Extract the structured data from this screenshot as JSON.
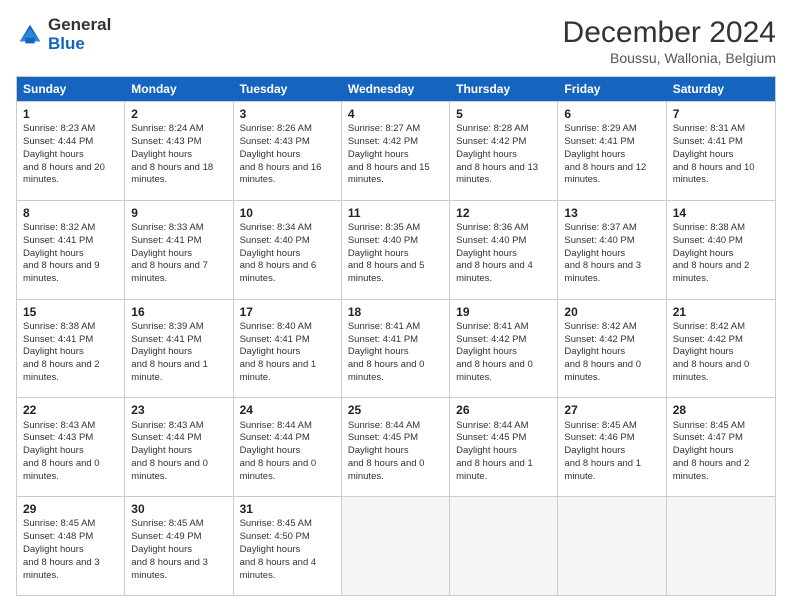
{
  "header": {
    "logo_general": "General",
    "logo_blue": "Blue",
    "month_title": "December 2024",
    "subtitle": "Boussu, Wallonia, Belgium"
  },
  "weekdays": [
    "Sunday",
    "Monday",
    "Tuesday",
    "Wednesday",
    "Thursday",
    "Friday",
    "Saturday"
  ],
  "weeks": [
    [
      {
        "day": "1",
        "sunrise": "8:23 AM",
        "sunset": "4:44 PM",
        "daylight": "8 hours and 20 minutes."
      },
      {
        "day": "2",
        "sunrise": "8:24 AM",
        "sunset": "4:43 PM",
        "daylight": "8 hours and 18 minutes."
      },
      {
        "day": "3",
        "sunrise": "8:26 AM",
        "sunset": "4:43 PM",
        "daylight": "8 hours and 16 minutes."
      },
      {
        "day": "4",
        "sunrise": "8:27 AM",
        "sunset": "4:42 PM",
        "daylight": "8 hours and 15 minutes."
      },
      {
        "day": "5",
        "sunrise": "8:28 AM",
        "sunset": "4:42 PM",
        "daylight": "8 hours and 13 minutes."
      },
      {
        "day": "6",
        "sunrise": "8:29 AM",
        "sunset": "4:41 PM",
        "daylight": "8 hours and 12 minutes."
      },
      {
        "day": "7",
        "sunrise": "8:31 AM",
        "sunset": "4:41 PM",
        "daylight": "8 hours and 10 minutes."
      }
    ],
    [
      {
        "day": "8",
        "sunrise": "8:32 AM",
        "sunset": "4:41 PM",
        "daylight": "8 hours and 9 minutes."
      },
      {
        "day": "9",
        "sunrise": "8:33 AM",
        "sunset": "4:41 PM",
        "daylight": "8 hours and 7 minutes."
      },
      {
        "day": "10",
        "sunrise": "8:34 AM",
        "sunset": "4:40 PM",
        "daylight": "8 hours and 6 minutes."
      },
      {
        "day": "11",
        "sunrise": "8:35 AM",
        "sunset": "4:40 PM",
        "daylight": "8 hours and 5 minutes."
      },
      {
        "day": "12",
        "sunrise": "8:36 AM",
        "sunset": "4:40 PM",
        "daylight": "8 hours and 4 minutes."
      },
      {
        "day": "13",
        "sunrise": "8:37 AM",
        "sunset": "4:40 PM",
        "daylight": "8 hours and 3 minutes."
      },
      {
        "day": "14",
        "sunrise": "8:38 AM",
        "sunset": "4:40 PM",
        "daylight": "8 hours and 2 minutes."
      }
    ],
    [
      {
        "day": "15",
        "sunrise": "8:38 AM",
        "sunset": "4:41 PM",
        "daylight": "8 hours and 2 minutes."
      },
      {
        "day": "16",
        "sunrise": "8:39 AM",
        "sunset": "4:41 PM",
        "daylight": "8 hours and 1 minute."
      },
      {
        "day": "17",
        "sunrise": "8:40 AM",
        "sunset": "4:41 PM",
        "daylight": "8 hours and 1 minute."
      },
      {
        "day": "18",
        "sunrise": "8:41 AM",
        "sunset": "4:41 PM",
        "daylight": "8 hours and 0 minutes."
      },
      {
        "day": "19",
        "sunrise": "8:41 AM",
        "sunset": "4:42 PM",
        "daylight": "8 hours and 0 minutes."
      },
      {
        "day": "20",
        "sunrise": "8:42 AM",
        "sunset": "4:42 PM",
        "daylight": "8 hours and 0 minutes."
      },
      {
        "day": "21",
        "sunrise": "8:42 AM",
        "sunset": "4:42 PM",
        "daylight": "8 hours and 0 minutes."
      }
    ],
    [
      {
        "day": "22",
        "sunrise": "8:43 AM",
        "sunset": "4:43 PM",
        "daylight": "8 hours and 0 minutes."
      },
      {
        "day": "23",
        "sunrise": "8:43 AM",
        "sunset": "4:44 PM",
        "daylight": "8 hours and 0 minutes."
      },
      {
        "day": "24",
        "sunrise": "8:44 AM",
        "sunset": "4:44 PM",
        "daylight": "8 hours and 0 minutes."
      },
      {
        "day": "25",
        "sunrise": "8:44 AM",
        "sunset": "4:45 PM",
        "daylight": "8 hours and 0 minutes."
      },
      {
        "day": "26",
        "sunrise": "8:44 AM",
        "sunset": "4:45 PM",
        "daylight": "8 hours and 1 minute."
      },
      {
        "day": "27",
        "sunrise": "8:45 AM",
        "sunset": "4:46 PM",
        "daylight": "8 hours and 1 minute."
      },
      {
        "day": "28",
        "sunrise": "8:45 AM",
        "sunset": "4:47 PM",
        "daylight": "8 hours and 2 minutes."
      }
    ],
    [
      {
        "day": "29",
        "sunrise": "8:45 AM",
        "sunset": "4:48 PM",
        "daylight": "8 hours and 3 minutes."
      },
      {
        "day": "30",
        "sunrise": "8:45 AM",
        "sunset": "4:49 PM",
        "daylight": "8 hours and 3 minutes."
      },
      {
        "day": "31",
        "sunrise": "8:45 AM",
        "sunset": "4:50 PM",
        "daylight": "8 hours and 4 minutes."
      },
      null,
      null,
      null,
      null
    ]
  ]
}
